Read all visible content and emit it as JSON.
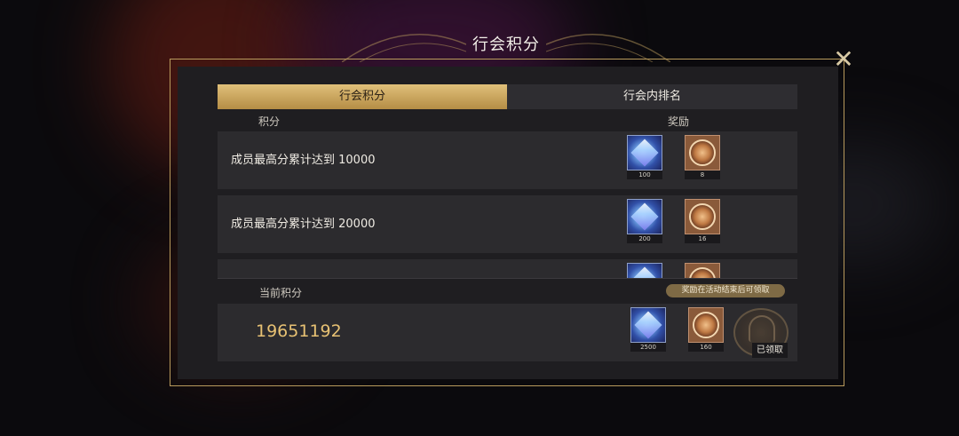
{
  "title": "行会积分",
  "tabs": [
    {
      "label": "行会积分",
      "active": true
    },
    {
      "label": "行会内排名",
      "active": false
    }
  ],
  "columns": {
    "score": "积分",
    "reward": "奖励"
  },
  "rows": [
    {
      "desc": "成员最高分累计达到 10000",
      "rewards": [
        {
          "icon": "crystal-icon",
          "qty": "100"
        },
        {
          "icon": "coin-icon",
          "qty": "8"
        }
      ]
    },
    {
      "desc": "成员最高分累计达到 20000",
      "rewards": [
        {
          "icon": "crystal-icon",
          "qty": "200"
        },
        {
          "icon": "coin-icon",
          "qty": "16"
        }
      ]
    },
    {
      "desc": "",
      "rewards": [
        {
          "icon": "crystal-icon",
          "qty": ""
        },
        {
          "icon": "coin-icon",
          "qty": ""
        }
      ]
    }
  ],
  "current": {
    "label": "当前积分",
    "note": "奖励在活动结束后可领取",
    "value": "19651192",
    "rewards": [
      {
        "icon": "crystal-icon",
        "qty": "2500"
      },
      {
        "icon": "coin-icon",
        "qty": "160"
      }
    ],
    "claimed_label": "已领取"
  },
  "colors": {
    "accent_gold": "#e0c07a",
    "score_text": "#e7c173",
    "frame": "#b89a5c"
  },
  "close_icon": "close-icon"
}
